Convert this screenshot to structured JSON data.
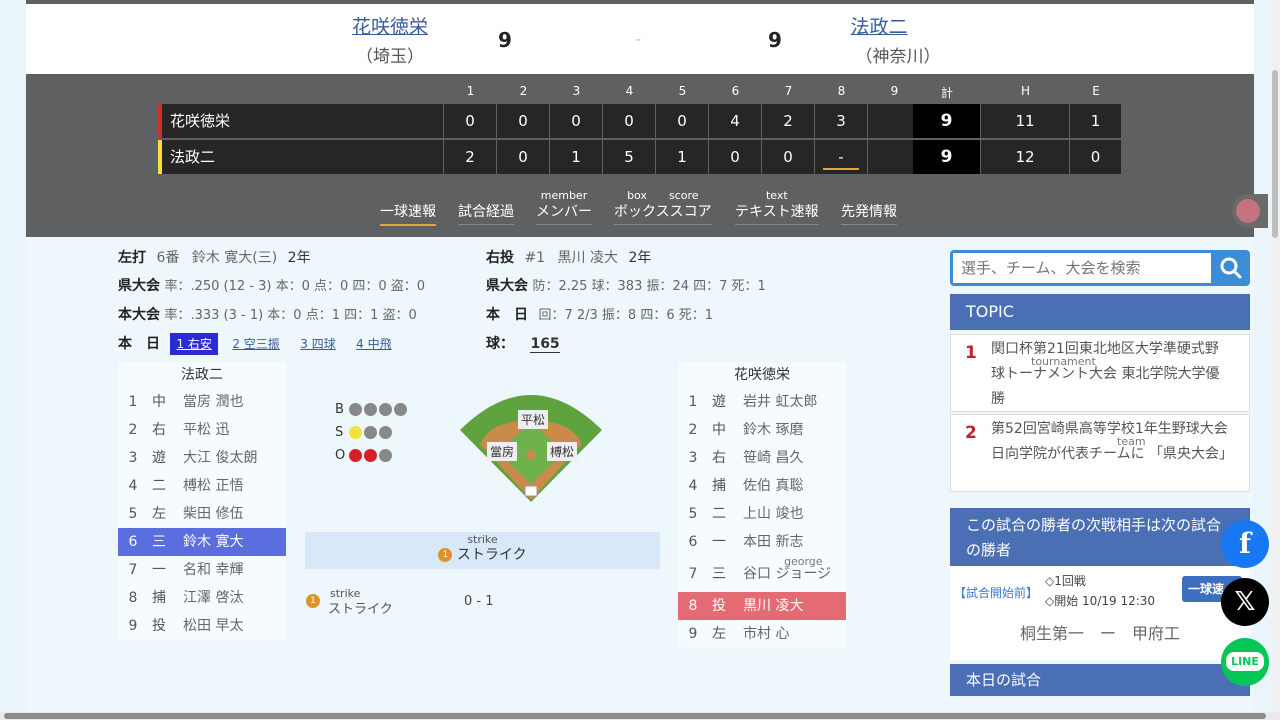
{
  "header": {
    "home": {
      "name": "花咲徳栄",
      "pref": "（埼玉）",
      "score": "9"
    },
    "away": {
      "name": "法政二",
      "pref": "（神奈川）",
      "score": "9"
    },
    "separator": "-"
  },
  "scoreboard": {
    "innings": [
      "1",
      "2",
      "3",
      "4",
      "5",
      "6",
      "7",
      "8",
      "9"
    ],
    "total_label": "計",
    "h_label": "H",
    "e_label": "E",
    "rows": [
      {
        "team": "花咲徳栄",
        "marker": "#d12c33",
        "scores": [
          "0",
          "0",
          "0",
          "0",
          "0",
          "4",
          "2",
          "3",
          ""
        ],
        "total": "9",
        "h": "11",
        "e": "1"
      },
      {
        "team": "法政二",
        "marker": "#f5e03a",
        "scores": [
          "2",
          "0",
          "1",
          "5",
          "1",
          "0",
          "0",
          "-",
          ""
        ],
        "total": "9",
        "h": "12",
        "e": "0"
      }
    ]
  },
  "tabs": [
    {
      "ruby": "",
      "label": "一球速報",
      "active": true
    },
    {
      "ruby": "",
      "label": "試合経過"
    },
    {
      "ruby": "member",
      "label": "メンバー"
    },
    {
      "ruby": "box　　score",
      "label": "ボックススコア"
    },
    {
      "ruby": "text",
      "label": "テキスト速報"
    },
    {
      "ruby": "",
      "label": "先発情報"
    }
  ],
  "batter": {
    "side": "左打",
    "order": "6番",
    "name": "鈴木 寛大(三)",
    "grade": "2年",
    "pref_label": "県大会",
    "pref_stats": "率：.250 (12 - 3)  本：0  点：0  四：0  盗：0",
    "tourney_label": "本大会",
    "tourney_stats": "率：.333 (3 - 1)  本：0  点：1  四：1  盗：0",
    "today_label": "本　日",
    "today": [
      "1 右安",
      "2 空三振",
      "3 四球",
      "4 中飛"
    ]
  },
  "pitcher": {
    "side": "右投",
    "number": "#1",
    "name": "黒川 凌大",
    "grade": "2年",
    "pref_label": "県大会",
    "pref_stats": "防：2.25  球：383  振：24  四：7  死：1",
    "today_label": "本　日",
    "today_stats": "回：7 2/3  振：8  四：6  死：1",
    "pitch_label": "球：",
    "pitch_count": "165"
  },
  "lineup_left": {
    "title": "法政二",
    "rows": [
      {
        "n": "1",
        "p": "中",
        "name": "當房 潤也"
      },
      {
        "n": "2",
        "p": "右",
        "name": "平松 迅"
      },
      {
        "n": "3",
        "p": "遊",
        "name": "大江 俊太朗"
      },
      {
        "n": "4",
        "p": "二",
        "name": "榑松 正悟"
      },
      {
        "n": "5",
        "p": "左",
        "name": "柴田 修伍"
      },
      {
        "n": "6",
        "p": "三",
        "name": "鈴木 寛大"
      },
      {
        "n": "7",
        "p": "一",
        "name": "名和 幸輝"
      },
      {
        "n": "8",
        "p": "捕",
        "name": "江澤 啓汰"
      },
      {
        "n": "9",
        "p": "投",
        "name": "松田 早太"
      }
    ]
  },
  "lineup_right": {
    "title": "花咲徳栄",
    "rows": [
      {
        "n": "1",
        "p": "遊",
        "name": "岩井 虹太郎"
      },
      {
        "n": "2",
        "p": "中",
        "name": "鈴木 琢磨"
      },
      {
        "n": "3",
        "p": "右",
        "name": "笹崎 昌久"
      },
      {
        "n": "4",
        "p": "捕",
        "name": "佐伯 真聡"
      },
      {
        "n": "5",
        "p": "二",
        "name": "上山 竣也"
      },
      {
        "n": "6",
        "p": "一",
        "name": "本田 新志"
      },
      {
        "n": "7",
        "p": "三",
        "name": "谷口 ジョージ",
        "ruby": "george"
      },
      {
        "n": "8",
        "p": "投",
        "name": "黒川 凌大"
      },
      {
        "n": "9",
        "p": "左",
        "name": "市村 心"
      }
    ]
  },
  "count": {
    "b": "B",
    "s": "S",
    "o": "O",
    "balls": 0,
    "strikes": 1,
    "outs": 2
  },
  "field": {
    "runner_2b": "平松",
    "runner_3b": "當房",
    "runner_1b": "榑松"
  },
  "pitch": {
    "ruby": "strike",
    "label": "ストライク",
    "num": "1",
    "log_ruby": "strike",
    "log_label": "ストライク",
    "log_count": "0 - 1"
  },
  "sidebar": {
    "search_placeholder": "選手、チーム、大会を検索",
    "topic_title": "TOPIC",
    "topics": [
      {
        "rank": "1",
        "text": "関口杯第21回東北地区大学準硬式野球トーナメント大会 東北学院大学優勝",
        "ruby": "tournament"
      },
      {
        "rank": "2",
        "text": "第52回宮崎県高等学校1年生野球大会 日向学院が代表チームに 「県央大会」",
        "ruby": "team"
      }
    ],
    "next_title": "この試合の勝者の次戦相手は次の試合の勝者",
    "next_status": "【試合開始前】",
    "next_round": "◇1回戦",
    "next_time": "◇開始 10/19 12:30",
    "next_button": "一球速",
    "next_match": "桐生第一　ー　甲府工",
    "today_title": "本日の試合"
  },
  "social": {
    "line": "LINE"
  }
}
